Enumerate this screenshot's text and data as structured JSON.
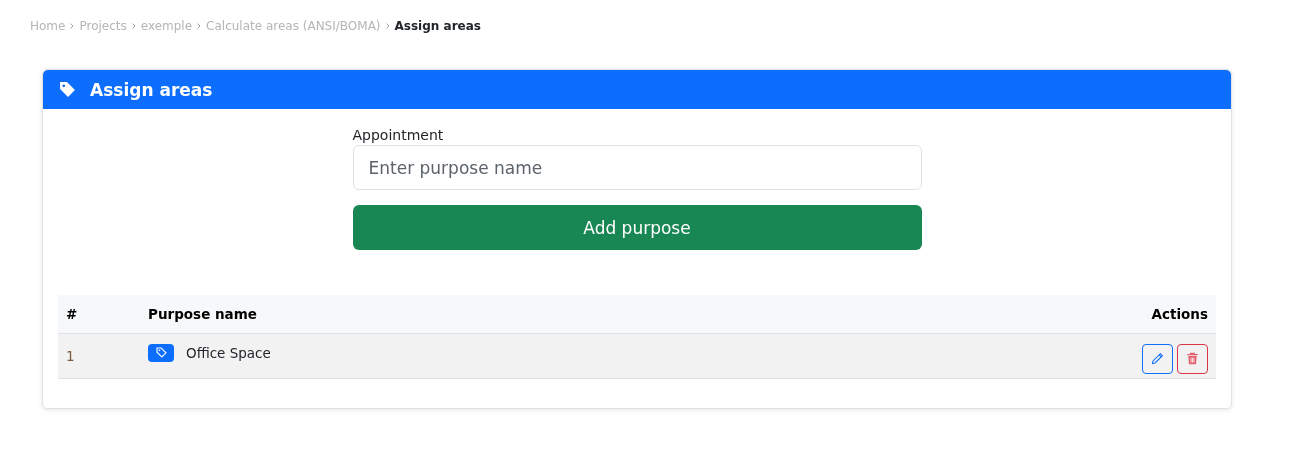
{
  "breadcrumb": [
    {
      "label": "Home",
      "current": false
    },
    {
      "label": "Projects",
      "current": false
    },
    {
      "label": "exemple",
      "current": false
    },
    {
      "label": "Calculate areas (ANSI/BOMA)",
      "current": false
    },
    {
      "label": "Assign areas",
      "current": true
    }
  ],
  "card": {
    "title": "Assign areas"
  },
  "form": {
    "label": "Appointment",
    "placeholder": "Enter purpose name",
    "button": "Add purpose"
  },
  "table": {
    "columns": [
      "#",
      "Purpose name",
      "Actions"
    ],
    "rows": [
      {
        "number": "1",
        "name": "Office Space"
      }
    ]
  }
}
